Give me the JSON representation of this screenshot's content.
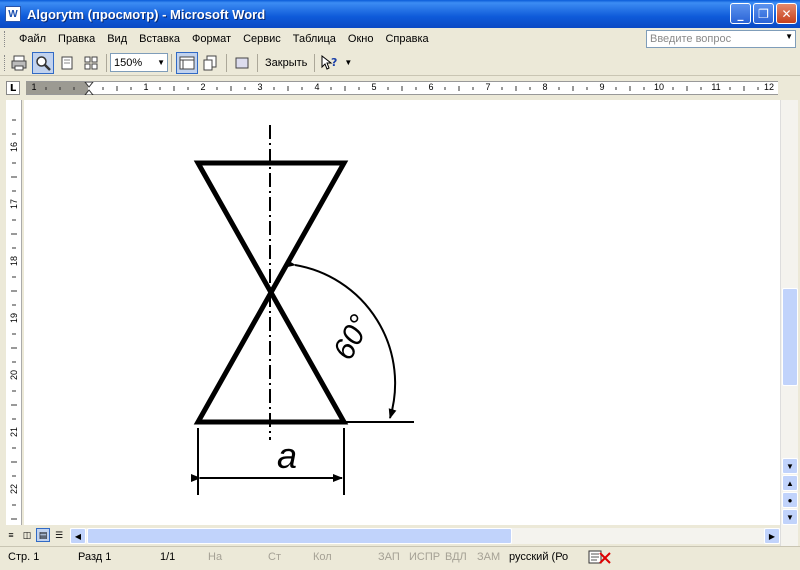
{
  "window": {
    "title": "Algorytm (просмотр) - Microsoft Word",
    "app_icon": "W",
    "controls": {
      "minimize": "_",
      "restore": "❐",
      "close": "✕"
    }
  },
  "menu": {
    "items": [
      "Файл",
      "Правка",
      "Вид",
      "Вставка",
      "Формат",
      "Сервис",
      "Таблица",
      "Окно",
      "Справка"
    ],
    "ask_placeholder": "Введите вопрос"
  },
  "toolbar": {
    "zoom": "150%",
    "close_label": "Закрыть"
  },
  "ruler": {
    "horizontal": [
      "1",
      "1",
      "2",
      "3",
      "4",
      "5",
      "6",
      "7",
      "8",
      "9",
      "10",
      "11",
      "12"
    ],
    "vertical": [
      "16",
      "17",
      "18",
      "19",
      "20",
      "21",
      "22"
    ]
  },
  "drawing": {
    "angle_label": "60°",
    "dimension_label": "a"
  },
  "status": {
    "page": "Стр. 1",
    "section": "Разд 1",
    "pages": "1/1",
    "at": "На",
    "line": "Ст",
    "col": "Кол",
    "rec": "ЗАП",
    "trk": "ИСПР",
    "ext": "ВДЛ",
    "ovr": "ЗАМ",
    "language": "русский (Ро"
  },
  "colors": {
    "titlebar": "#0A5BD8",
    "chrome": "#ECE9D8",
    "scroll": "#C1D3FB"
  }
}
